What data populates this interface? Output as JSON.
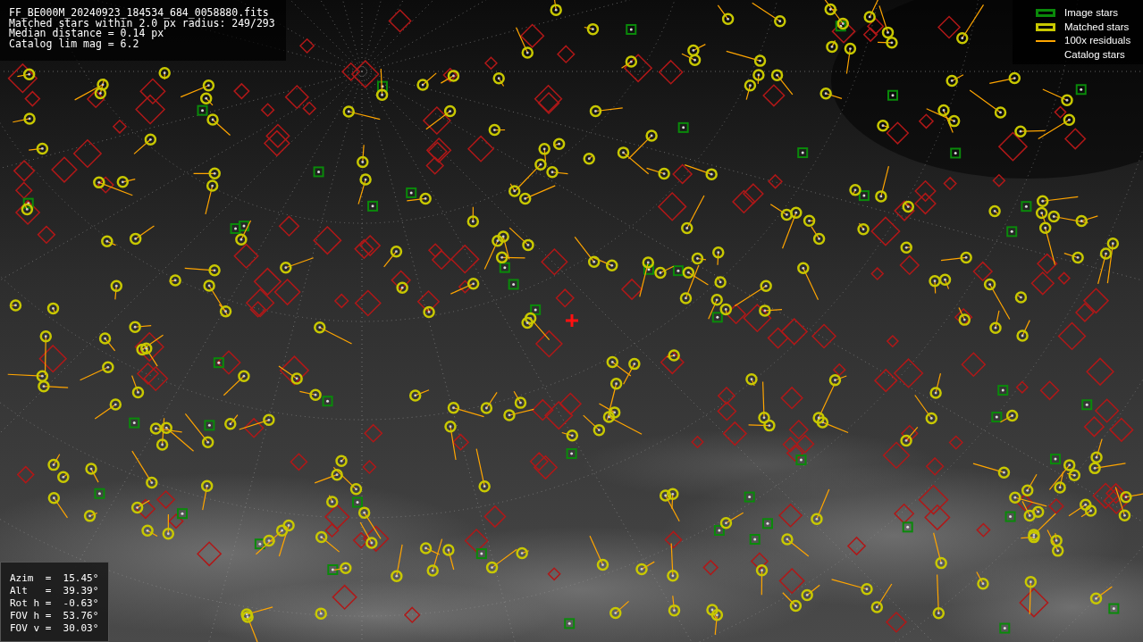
{
  "info_lines": [
    "FF_BE000M_20240923_184534_684_0058880.fits",
    "Matched stars within 2.0 px radius: 249/293",
    "Median distance = 0.14 px",
    "Catalog lim mag = 6.2"
  ],
  "legend": [
    {
      "kind": "box",
      "label": "Image stars",
      "color": "#0a8a0a"
    },
    {
      "kind": "box",
      "label": "Matched stars",
      "color": "#c8c800"
    },
    {
      "kind": "line",
      "label": "100x residuals",
      "color": "#ffa500"
    },
    {
      "kind": "none",
      "label": "Catalog stars"
    }
  ],
  "pointing_lines": [
    "Azim  =  15.45°",
    "Alt   =  39.39°",
    "Rot h =  -0.63°",
    "FOV h =  53.76°",
    "FOV v =  30.03°"
  ]
}
